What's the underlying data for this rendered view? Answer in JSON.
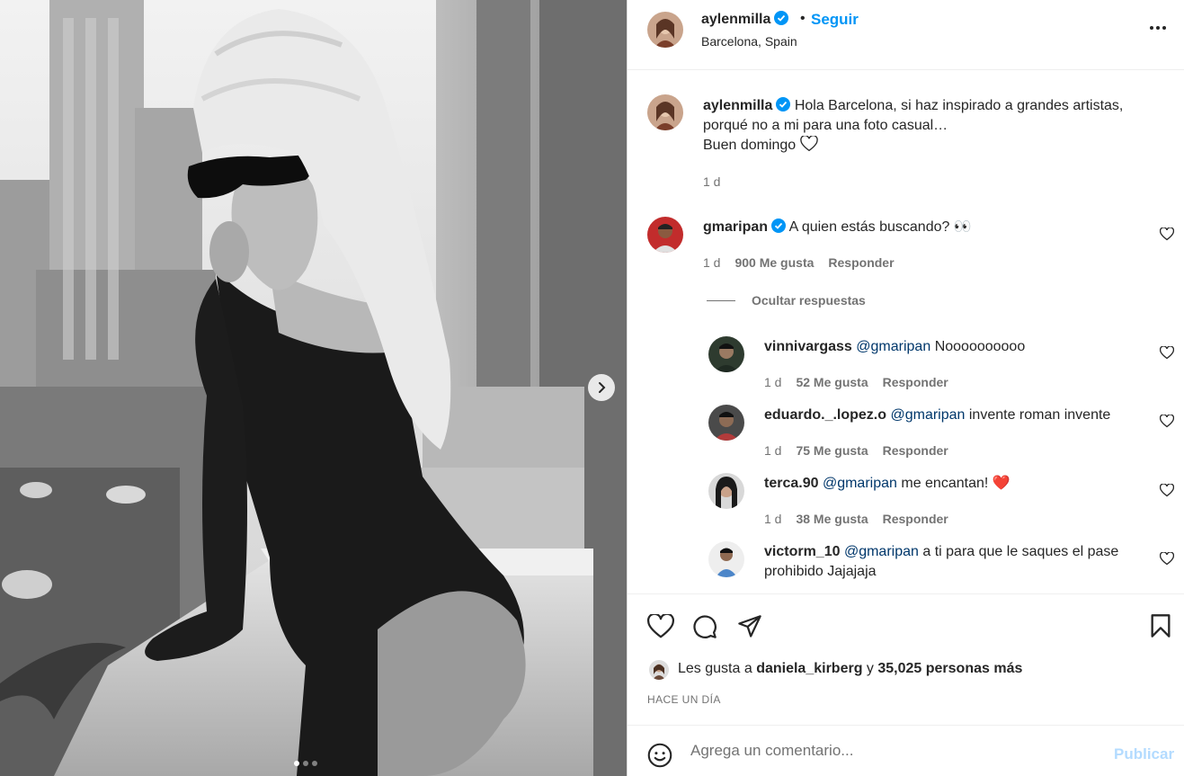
{
  "post": {
    "author": "aylenmilla",
    "follow_label": "Seguir",
    "separator": "•",
    "location": "Barcelona, Spain",
    "caption_lines": [
      "Hola Barcelona, si haz inspirado a grandes artistas,",
      "porqué no a mi para una foto casual…",
      "Buen domingo"
    ],
    "caption_time": "1 d",
    "carousel": {
      "total_slides": 3,
      "active_slide": 1
    }
  },
  "comments": [
    {
      "user": "gmaripan",
      "verified": true,
      "text": "A quien estás buscando? 👀",
      "time": "1 d",
      "likes": "900 Me gusta",
      "reply": "Responder"
    }
  ],
  "hide_replies_label": "Ocultar respuestas",
  "replies": [
    {
      "user": "vinnivargass",
      "mention": "@gmaripan",
      "text": "Noooooooooo",
      "time": "1 d",
      "likes": "52 Me gusta",
      "reply": "Responder"
    },
    {
      "user": "eduardo._.lopez.o",
      "mention": "@gmaripan",
      "text": "invente roman invente",
      "time": "1 d",
      "likes": "75 Me gusta",
      "reply": "Responder"
    },
    {
      "user": "terca.90",
      "mention": "@gmaripan",
      "text": "me encantan! ❤️",
      "time": "1 d",
      "likes": "38 Me gusta",
      "reply": "Responder"
    },
    {
      "user": "victorm_10",
      "mention": "@gmaripan",
      "text_line1": "a ti para que le saques el pase",
      "text_line2": "prohibido Jajajaja"
    }
  ],
  "likes_bar": {
    "prefix": "Les gusta a",
    "user": "daniela_kirberg",
    "middle": "y",
    "others": "35,025 personas más"
  },
  "date_label": "HACE UN DÍA",
  "composer": {
    "placeholder": "Agrega un comentario...",
    "publish_label": "Publicar"
  },
  "colors": {
    "accent": "#0095f6",
    "verified": "#0095f6",
    "muted": "#737373",
    "publish_disabled": "#b3dbff",
    "heart_red": "#ed1c24"
  },
  "icons": [
    "verified-icon",
    "more-options-icon",
    "heart-icon",
    "comment-icon",
    "share-icon",
    "bookmark-icon",
    "emoji-icon",
    "chevron-right-icon"
  ]
}
